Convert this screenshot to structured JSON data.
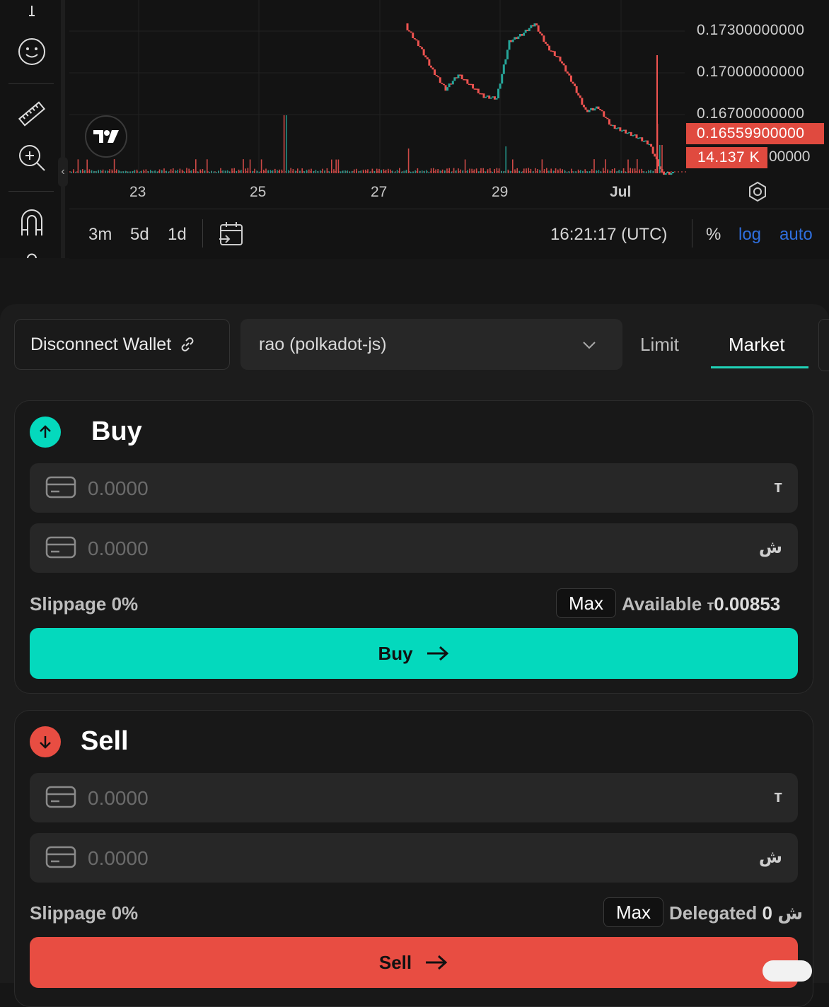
{
  "chart": {
    "price_axis": [
      "0.17300000000",
      "0.17000000000",
      "0.16700000000"
    ],
    "current_price": "0.16559900000",
    "volume_tag": "14.137 K",
    "volume_suffix": "00000",
    "x_axis": [
      "23",
      "25",
      "27",
      "29",
      "Jul"
    ],
    "ranges": [
      "3m",
      "5d",
      "1d"
    ],
    "time": "16:21:17 (UTC)",
    "pct": "%",
    "log": "log",
    "auto": "auto",
    "colors": {
      "up": "#26a69a",
      "down": "#ef5350"
    }
  },
  "chart_data": {
    "type": "line",
    "title": "",
    "x": [
      "23",
      "25",
      "27",
      "29",
      "Jul"
    ],
    "ylim": [
      0.1656,
      0.1745
    ],
    "series": [
      {
        "values": [
          0.1735,
          0.1725,
          0.1712,
          0.1702,
          0.171,
          0.1704,
          0.1698,
          0.1697,
          0.1728,
          0.1732,
          0.1738,
          0.1725,
          0.1718,
          0.1705,
          0.169,
          0.1692,
          0.1682,
          0.1679,
          0.1676,
          0.1672,
          0.1656
        ]
      }
    ],
    "grid": true
  },
  "panel": {
    "disconnect_label": "Disconnect Wallet",
    "wallet_value": "rao (polkadot-js)",
    "tabs": [
      "Limit",
      "Market"
    ],
    "active_tab": "Market"
  },
  "buy": {
    "title": "Buy",
    "field1_placeholder": "0.0000",
    "field1_unit": "т",
    "field2_placeholder": "0.0000",
    "field2_unit": "ش",
    "slippage": "Slippage 0%",
    "max": "Max",
    "available_label": "Available",
    "available_unit": "т",
    "available_value": "0.00853",
    "button": "Buy",
    "color": "#04d9bd"
  },
  "sell": {
    "title": "Sell",
    "field1_placeholder": "0.0000",
    "field1_unit": "т",
    "field2_placeholder": "0.0000",
    "field2_unit": "ش",
    "slippage": "Slippage 0%",
    "max": "Max",
    "delegated_label": "Delegated",
    "delegated_value": "0",
    "delegated_unit": "ش",
    "button": "Sell",
    "color": "#e84d42"
  }
}
